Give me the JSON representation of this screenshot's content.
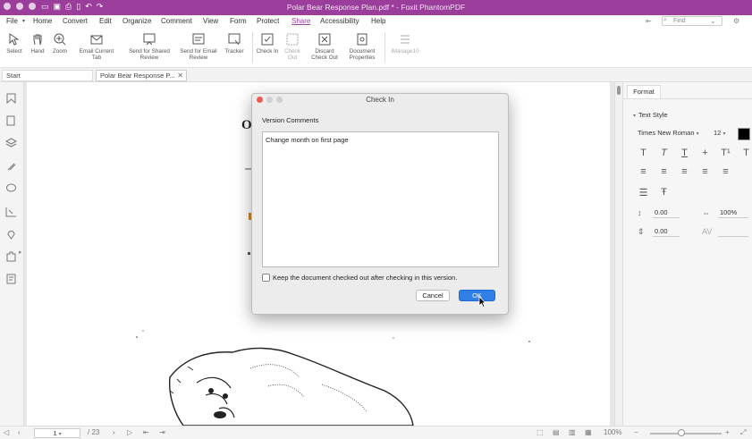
{
  "window": {
    "title": "Polar Bear Response Plan.pdf * - Foxit PhantomPDF"
  },
  "menubar": {
    "items": [
      "File",
      "Home",
      "Convert",
      "Edit",
      "Organize",
      "Comment",
      "View",
      "Form",
      "Protect",
      "Share",
      "Accessibility",
      "Help"
    ],
    "active": "Share",
    "search_placeholder": "Find"
  },
  "ribbon": {
    "buttons": [
      {
        "label": "Select",
        "icon": "select-cursor-icon"
      },
      {
        "label": "Hand",
        "icon": "hand-icon"
      },
      {
        "label": "Zoom",
        "icon": "zoom-icon"
      },
      {
        "label": "Email Current Tab",
        "icon": "email-icon"
      },
      {
        "label": "Send for Shared Review",
        "icon": "shared-review-icon"
      },
      {
        "label": "Send for Email Review",
        "icon": "email-review-icon"
      },
      {
        "label": "Tracker",
        "icon": "tracker-icon"
      },
      {
        "label": "Check In",
        "icon": "check-in-icon"
      },
      {
        "label": "Check Out",
        "icon": "check-out-icon"
      },
      {
        "label": "Discard Check Out",
        "icon": "discard-check-out-icon"
      },
      {
        "label": "Document Properties",
        "icon": "document-properties-icon"
      },
      {
        "label": "iManage10",
        "icon": "imanage-icon"
      }
    ]
  },
  "tabs": {
    "start": "Start",
    "document": "Polar Bear Response P..."
  },
  "dialog": {
    "title": "Check In",
    "comments_label": "Version Comments",
    "comments_value": "Change month on first page",
    "keep_checked_out_label": "Keep the document checked out after checking in this version.",
    "cancel_label": "Cancel",
    "ok_label": "OK"
  },
  "right_panel": {
    "tab": "Format",
    "section": "Text Style",
    "font_name": "Times New Roman",
    "font_size": "12",
    "font_color": "#000000",
    "line_spacing": "0.00",
    "horizontal_scale": "100%",
    "paragraph_spacing": "0.00"
  },
  "statusbar": {
    "page_current": "1",
    "page_total": "/ 23",
    "zoom": "100%"
  },
  "colors": {
    "brand": "#9b3d9b",
    "ok_button": "#2f7fe6"
  }
}
